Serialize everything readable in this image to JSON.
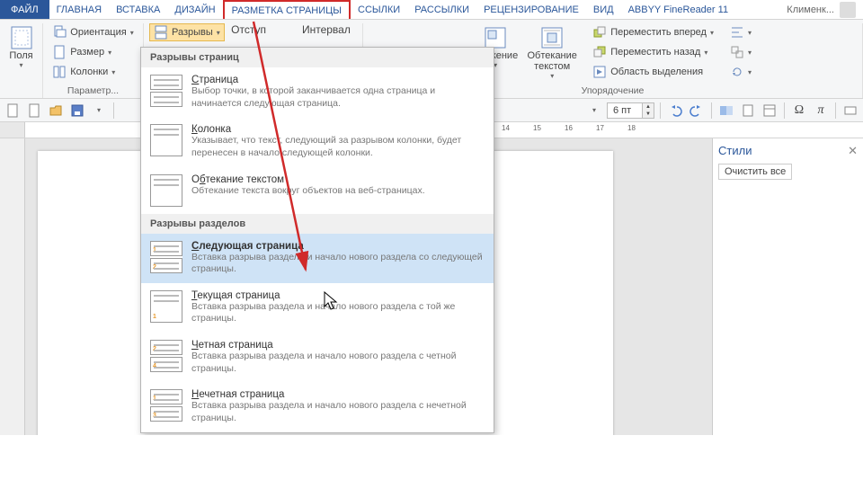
{
  "menubar": {
    "file": "ФАЙЛ",
    "tabs": [
      "ГЛАВНАЯ",
      "ВСТАВКА",
      "ДИЗАЙН",
      "РАЗМЕТКА СТРАНИЦЫ",
      "ССЫЛКИ",
      "РАССЫЛКИ",
      "РЕЦЕНЗИРОВАНИЕ",
      "ВИД",
      "ABBYY FineReader 11"
    ],
    "active_index": 3,
    "user": "Клименк..."
  },
  "ribbon": {
    "fields": {
      "label": "Поля"
    },
    "page_setup": {
      "orientation": "Ориентация",
      "size": "Размер",
      "columns": "Колонки",
      "breaks": "Разрывы",
      "group_label": "Параметр..."
    },
    "paragraph": {
      "indent_label": "Отступ",
      "spacing_label": "Интервал"
    },
    "arrange": {
      "position": "оложение",
      "wrap": "Обтекание текстом",
      "bring_forward": "Переместить вперед",
      "send_backward": "Переместить назад",
      "selection_pane": "Область выделения",
      "group_label": "Упорядочение"
    }
  },
  "qat": {
    "spacing_value": "6 пт"
  },
  "ruler": {
    "marks": [
      "14",
      "15",
      "16",
      "17",
      "18"
    ]
  },
  "styles_pane": {
    "title": "Стили",
    "clear": "Очистить все"
  },
  "breaks_menu": {
    "section_page": "Разрывы страниц",
    "section_sect": "Разрывы разделов",
    "items_page": [
      {
        "title": "Страница",
        "desc": "Выбор точки, в которой заканчивается одна страница и начинается следующая страница."
      },
      {
        "title": "Колонка",
        "desc": "Указывает, что текст, следующий за разрывом колонки, будет перенесен в начало следующей колонки."
      },
      {
        "title": "Обтекание текстом",
        "desc": "Обтекание текста вокруг объектов на веб-страницах."
      }
    ],
    "items_sect": [
      {
        "title": "Следующая страница",
        "desc": "Вставка разрыва раздела и начало нового раздела со следующей страницы."
      },
      {
        "title": "Текущая страница",
        "desc": "Вставка разрыва раздела и начало нового раздела с той же страницы."
      },
      {
        "title": "Четная страница",
        "desc": "Вставка разрыва раздела и начало нового раздела с четной страницы."
      },
      {
        "title": "Нечетная страница",
        "desc": "Вставка разрыва раздела и начало нового раздела с нечетной страницы."
      }
    ],
    "hover_index": 0
  }
}
